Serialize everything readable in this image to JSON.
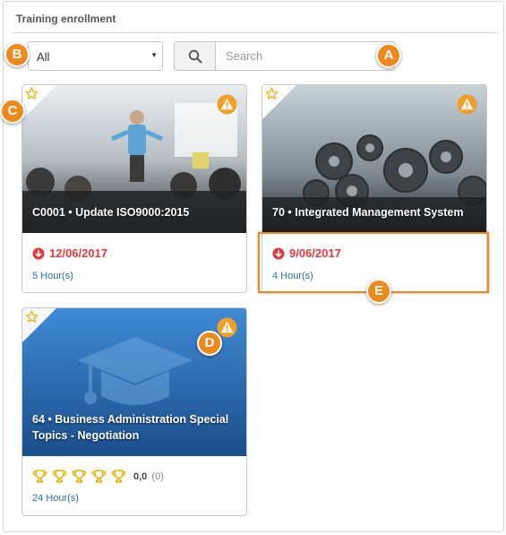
{
  "panel": {
    "title": "Training enrollment"
  },
  "filter": {
    "selected": "All"
  },
  "search": {
    "placeholder": "Search"
  },
  "cards": [
    {
      "title": "C0001 • Update ISO9000:2015",
      "due_date": "12/06/2017",
      "hours": "5 Hour(s)"
    },
    {
      "title": "70 • Integrated Management System",
      "due_date": "9/06/2017",
      "hours": "4 Hour(s)"
    },
    {
      "title": "64 • Business Administration Special Topics - Negotiation",
      "rating_value": "0,0",
      "rating_count": "(0)",
      "hours": "24 Hour(s)"
    }
  ],
  "callouts": {
    "a": "A",
    "b": "B",
    "c": "C",
    "d": "D",
    "e": "E"
  },
  "colors": {
    "accent": "#ee8a1c",
    "due": "#e03a3e",
    "link": "#2a6fb1",
    "trophy": "#e8b100"
  }
}
